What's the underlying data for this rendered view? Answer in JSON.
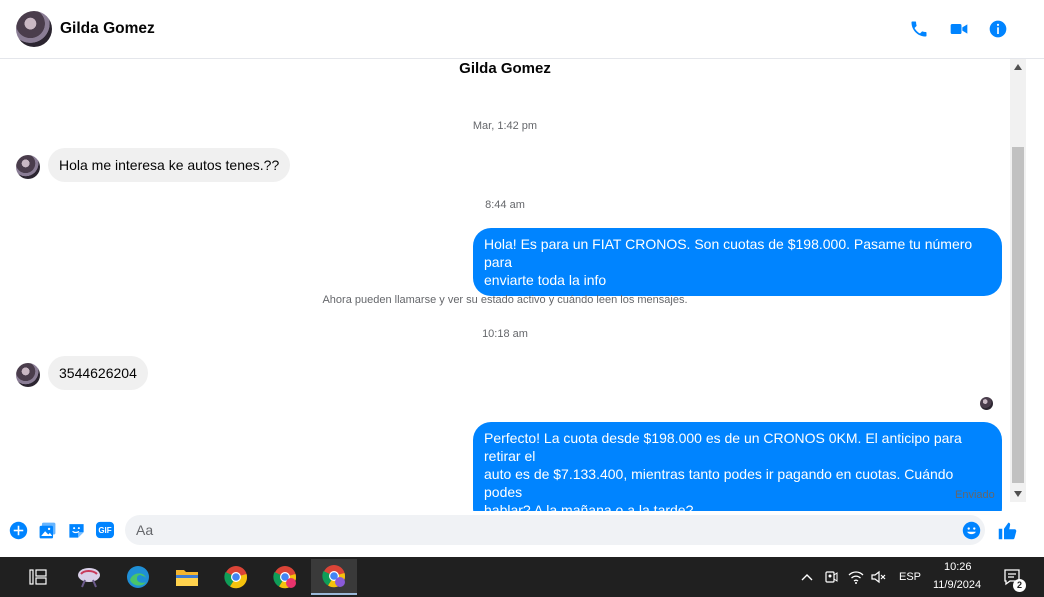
{
  "header": {
    "contact_name": "Gilda Gomez"
  },
  "chat": {
    "title": "Gilda Gomez",
    "messages": [
      {
        "type": "timestamp",
        "text": "Mar, 1:42 pm"
      },
      {
        "type": "incoming",
        "text": "Hola me interesa ke autos tenes.??"
      },
      {
        "type": "timestamp",
        "text": "8:44 am"
      },
      {
        "type": "outgoing",
        "lines": [
          "Hola! Es para un FIAT CRONOS. Son cuotas de $198.000. Pasame tu número para",
          "enviarte toda la info"
        ]
      },
      {
        "type": "system",
        "text": "Ahora pueden llamarse y ver su estado activo y cuándo leen los mensajes."
      },
      {
        "type": "timestamp",
        "text": "10:18 am"
      },
      {
        "type": "incoming",
        "text": "3544626204"
      },
      {
        "type": "outgoing",
        "lines": [
          "Perfecto! La cuota desde $198.000 es de un CRONOS 0KM. El anticipo para retirar el",
          "auto es de $7.133.400, mientras tanto podes ir pagando en cuotas. Cuándo podes",
          "hablar? A la mañana o a la tarde?"
        ]
      }
    ],
    "status": "Enviado"
  },
  "composer": {
    "placeholder": "Aa",
    "gif_label": "GIF"
  },
  "taskbar": {
    "language": "ESP",
    "time": "10:26",
    "date": "11/9/2024",
    "notification_count": "2"
  },
  "colors": {
    "accent": "#0084ff",
    "incoming_bubble": "#f0f0f0",
    "taskbar": "#202020"
  }
}
